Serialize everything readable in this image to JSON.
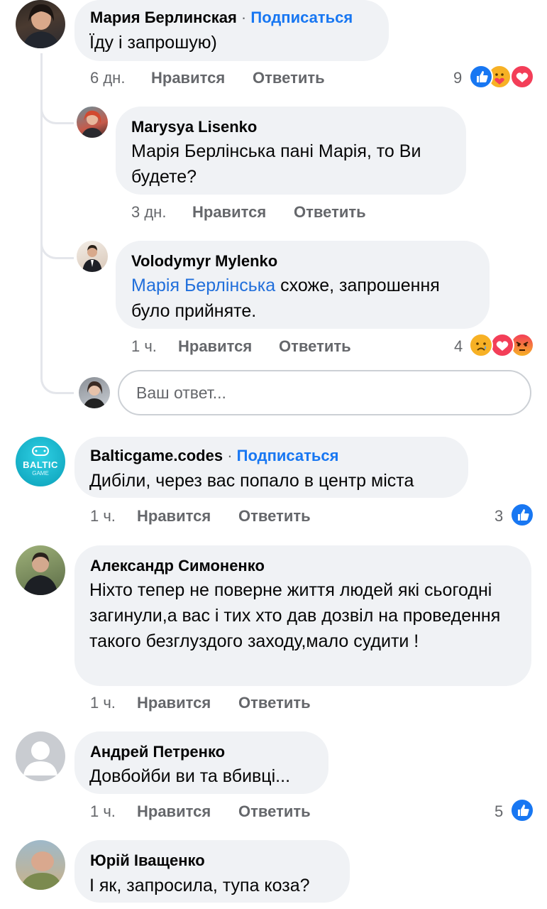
{
  "colors": {
    "bubble": "#f0f2f5",
    "link": "#1877f2",
    "meta": "#65676b",
    "like": "#1877f2",
    "love": "#f33e58",
    "angry": "#e9710f",
    "sad": "#f7b125"
  },
  "comments": [
    {
      "author": "Мария Берлинская",
      "separator": "·",
      "follow": "Подписаться",
      "text": "Їду і запрошую)",
      "time": "6 дн.",
      "like_label": "Нравится",
      "reply_label": "Ответить",
      "reaction_count": "9",
      "reactions": [
        "like-icon",
        "care-icon",
        "love-icon"
      ]
    },
    {
      "author": "Marysya Lisenko",
      "text": "Марія Берлінська пані Марія, то Ви будете?",
      "time": "3 дн.",
      "like_label": "Нравится",
      "reply_label": "Ответить"
    },
    {
      "author": "Volodymyr Mylenko",
      "mention": "Марія Берлінська",
      "text": " схоже, запрошення було прийняте.",
      "time": "1 ч.",
      "like_label": "Нравится",
      "reply_label": "Ответить",
      "reaction_count": "4",
      "reactions": [
        "sad-icon",
        "love-icon",
        "angry-icon"
      ]
    },
    {
      "author": "Balticgame.codes",
      "separator": "·",
      "follow": "Подписаться",
      "text": "Дибіли, через вас попало в центр міста",
      "time": "1 ч.",
      "like_label": "Нравится",
      "reply_label": "Ответить",
      "reaction_count": "3",
      "reactions": [
        "like-icon"
      ],
      "avatar_text": "BALTIC",
      "avatar_subtext": "GAME"
    },
    {
      "author": "Александр Симоненко",
      "text": "Ніхто тепер не поверне життя людей які сьогодні загинули,а вас і тих хто дав дозвіл на проведення такого безглуздого заходу,мало судити !",
      "time": "1 ч.",
      "like_label": "Нравится",
      "reply_label": "Ответить"
    },
    {
      "author": "Андрей Петренко",
      "text": "Довбойби ви та вбивці...",
      "time": "1 ч.",
      "like_label": "Нравится",
      "reply_label": "Ответить",
      "reaction_count": "5",
      "reactions": [
        "like-icon"
      ]
    },
    {
      "author": "Юрій Іващенко",
      "text": "І як, запросила, тупа коза?"
    }
  ],
  "reply_box": {
    "placeholder": "Ваш ответ..."
  }
}
